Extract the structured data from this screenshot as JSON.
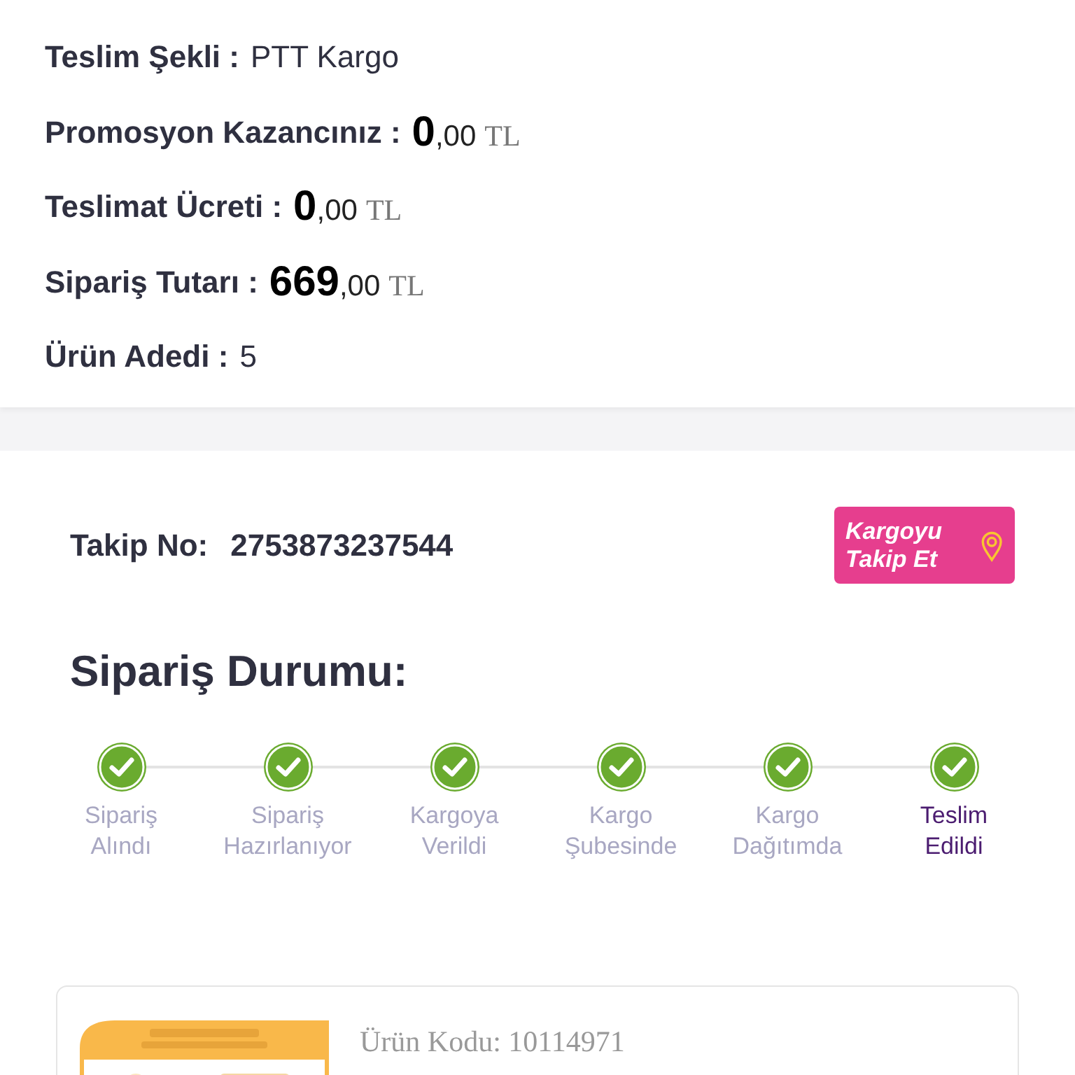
{
  "summary": [
    {
      "kind": "text",
      "label": "Teslim Şekli :",
      "value": "PTT Kargo"
    },
    {
      "kind": "price",
      "label": "Promosyon Kazancınız :",
      "integer": "0",
      "decimals": ",00",
      "currency": "TL"
    },
    {
      "kind": "price",
      "label": "Teslimat Ücreti :",
      "integer": "0",
      "decimals": ",00",
      "currency": "TL"
    },
    {
      "kind": "price",
      "label": "Sipariş Tutarı :",
      "integer": "669",
      "decimals": ",00",
      "currency": "TL"
    },
    {
      "kind": "text",
      "label": "Ürün Adedi :",
      "value": "5"
    }
  ],
  "tracking": {
    "label": "Takip No:",
    "number": "2753873237544",
    "button": "Kargoyu Takip Et"
  },
  "status": {
    "title": "Sipariş Durumu:",
    "steps": [
      {
        "label": "Sipariş Alındı",
        "done": true,
        "active": false
      },
      {
        "label": "Sipariş Hazırlanıyor",
        "done": true,
        "active": false
      },
      {
        "label": "Kargoya Verildi",
        "done": true,
        "active": false
      },
      {
        "label": "Kargo Şubesinde",
        "done": true,
        "active": false
      },
      {
        "label": "Kargo Dağıtımda",
        "done": true,
        "active": false
      },
      {
        "label": "Teslim Edildi",
        "done": true,
        "active": true
      }
    ]
  },
  "product": {
    "code": "Ürün Kodu: 10114971"
  }
}
